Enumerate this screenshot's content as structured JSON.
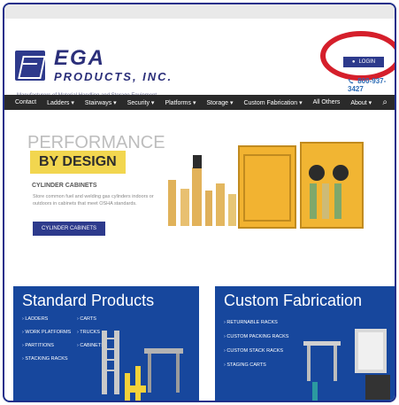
{
  "header": {
    "logo_text_line1": "EGA",
    "logo_text_line2": "PRODUCTS, INC.",
    "tagline": "Manufacturers of Material Handling and Storage Equipment",
    "login_label": "LOGIN",
    "phone": "800-937-3427"
  },
  "nav": {
    "items": [
      "Contact",
      "Ladders ▾",
      "Stairways ▾",
      "Security ▾",
      "Platforms ▾",
      "Storage ▾",
      "Custom Fabrication ▾",
      "All Others",
      "About ▾"
    ]
  },
  "hero": {
    "headline": "PERFORMANCE",
    "highlight": "BY DESIGN",
    "subheading": "CYLINDER CABINETS",
    "description": "Store common fuel and welding gas cylinders indoors or outdoors in cabinets that meet OSHA standards.",
    "cta_label": "CYLINDER CABINETS"
  },
  "standard_products": {
    "title": "Standard Products",
    "items": [
      "LADDERS",
      "CARTS",
      "WORK PLATFORMS",
      "TRUCKS",
      "PARTITIONS",
      "CABINETS",
      "STACKING RACKS"
    ]
  },
  "custom_fabrication": {
    "title": "Custom Fabrication",
    "items": [
      "RETURNABLE RACKS",
      "CUSTOM PACKING RACKS",
      "CUSTOM STACK RACKS",
      "STAGING CARTS"
    ]
  },
  "colors": {
    "brand_blue": "#2d3a8c",
    "nav_bg": "#2a2a2a",
    "panel_blue": "#17479d",
    "highlight_yellow": "#f2d64f",
    "annotation_red": "#d51f2b"
  }
}
